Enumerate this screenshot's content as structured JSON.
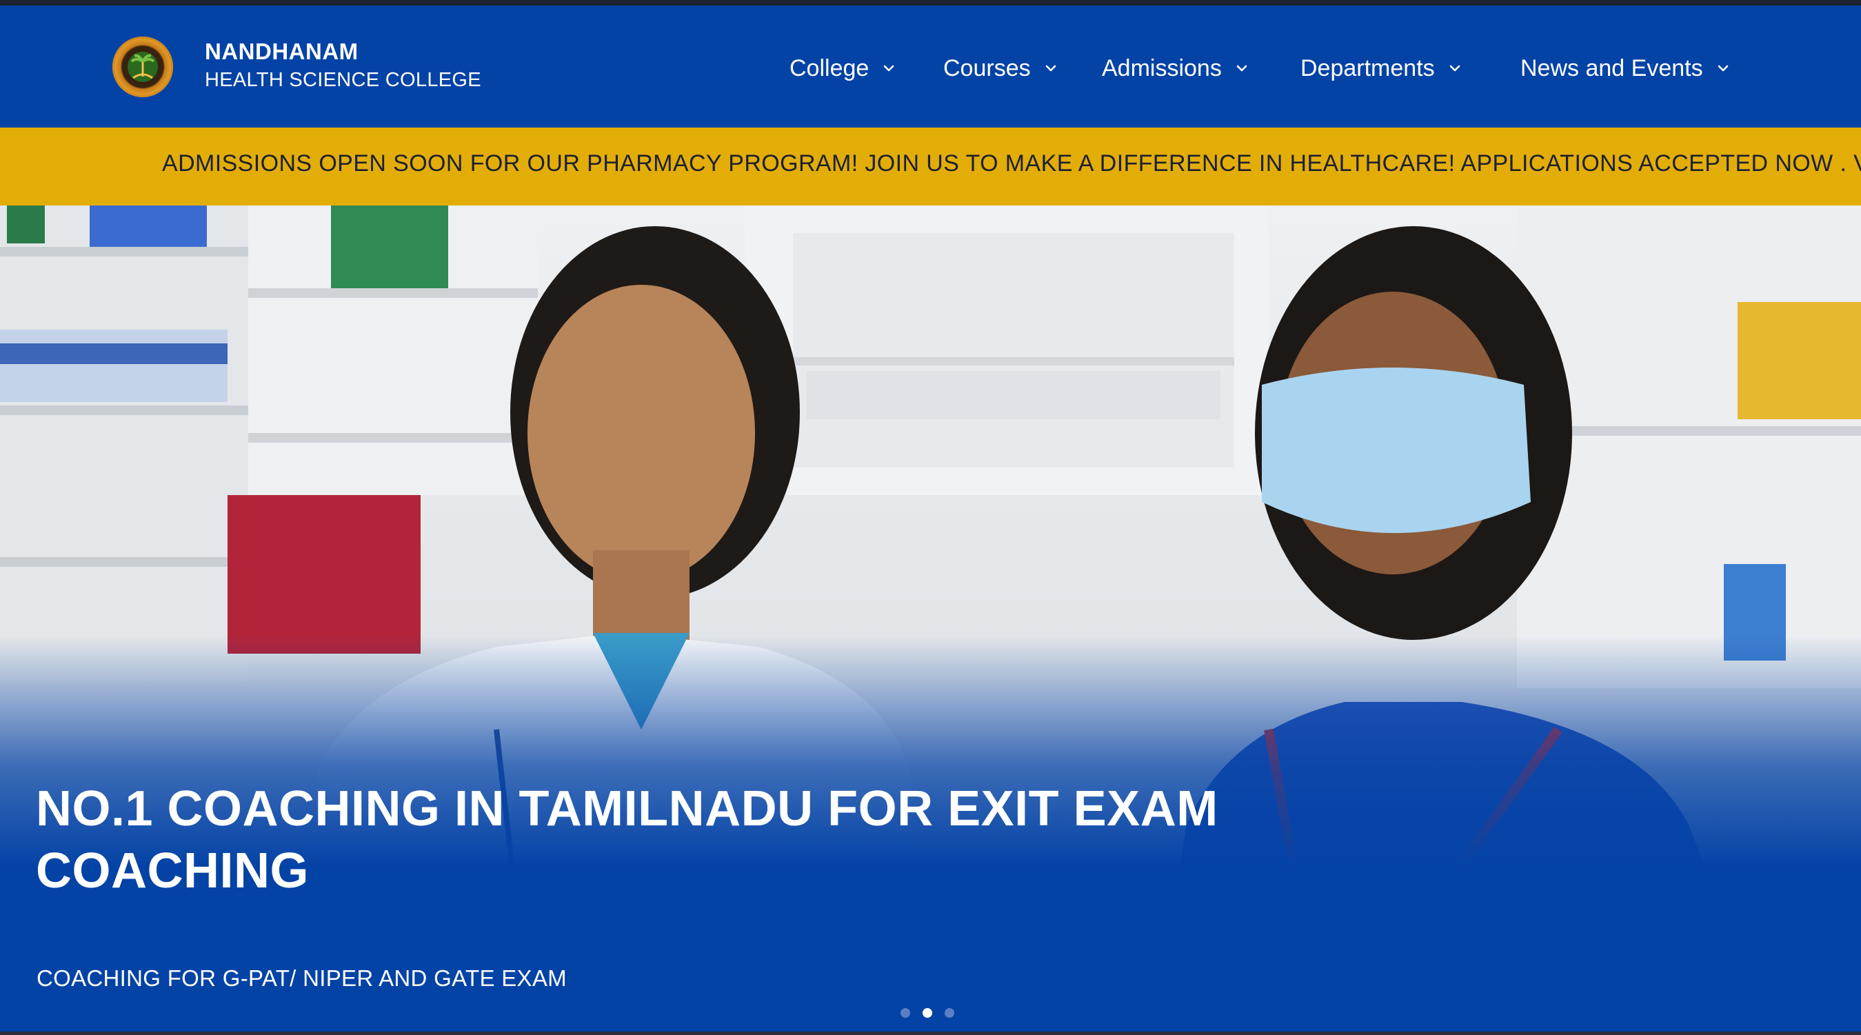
{
  "brand": {
    "name": "NANDHANAM",
    "subtitle": "HEALTH SCIENCE COLLEGE",
    "logo_icon": "college-emblem-icon"
  },
  "nav": {
    "items": [
      {
        "label": "College",
        "icon": "chevron-down-icon"
      },
      {
        "label": "Courses",
        "icon": "chevron-down-icon"
      },
      {
        "label": "Admissions",
        "icon": "chevron-down-icon"
      },
      {
        "label": "Departments",
        "icon": "chevron-down-icon"
      },
      {
        "label": "News and Events",
        "icon": "chevron-down-icon"
      }
    ]
  },
  "ticker": {
    "text": "ADMISSIONS OPEN SOON FOR OUR PHARMACY PROGRAM! JOIN US TO MAKE A DIFFERENCE IN HEALTHCARE! APPLICATIONS ACCEPTED NOW . VISIT C"
  },
  "hero": {
    "title_line1": "NO.1 COACHING IN TAMILNADU FOR EXIT EXAM",
    "title_line2": "COACHING",
    "subtitle": "COACHING FOR G-PAT/ NIPER AND GATE EXAM",
    "slides_total": 3,
    "active_slide": 2
  },
  "colors": {
    "header_bg": "#0443a6",
    "ticker_bg": "#e3ad08",
    "ticker_text": "#1d2130",
    "hero_overlay": "#0443a6"
  }
}
